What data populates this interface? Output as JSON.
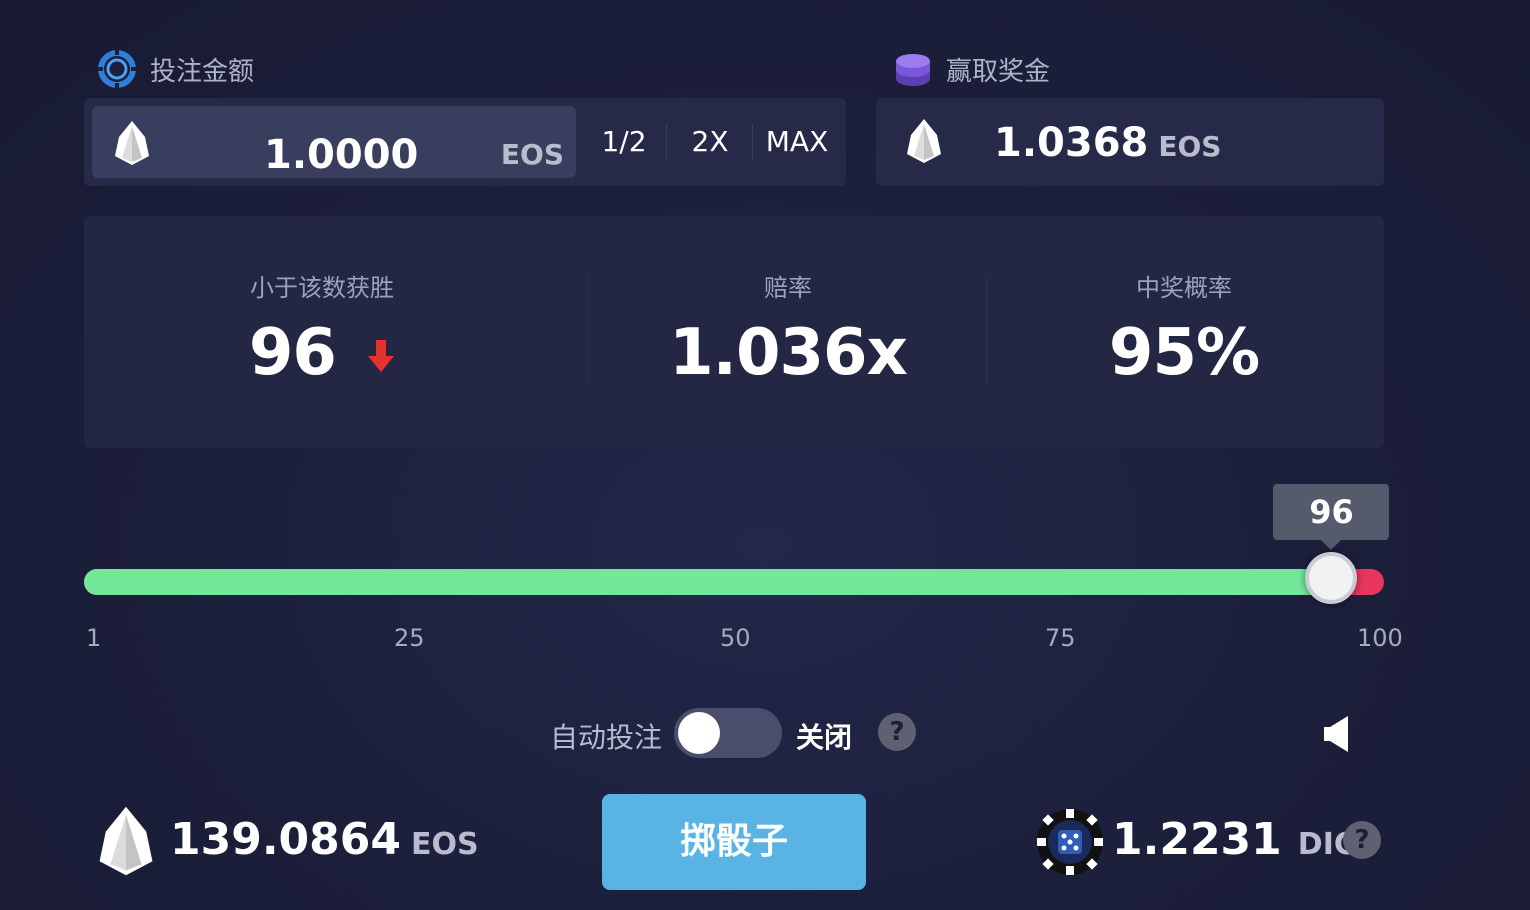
{
  "bet": {
    "label": "投注金额",
    "value": "1.0000",
    "unit": "EOS",
    "half_label": "1/2",
    "double_label": "2X",
    "max_label": "MAX"
  },
  "win": {
    "label": "赢取奖金",
    "value": "1.0368",
    "unit": "EOS"
  },
  "stats": {
    "roll_under_label": "小于该数获胜",
    "roll_under_value": "96",
    "payout_label": "赔率",
    "payout_value": "1.036x",
    "chance_label": "中奖概率",
    "chance_value": "95%"
  },
  "slider": {
    "value": 96,
    "min": 1,
    "max": 100,
    "tooltip": "96",
    "ticks": [
      "1",
      "25",
      "50",
      "75",
      "100"
    ],
    "win_color": "#74e89a",
    "lose_color": "#e8365f"
  },
  "auto_bet": {
    "label": "自动投注",
    "state": "关闭",
    "help": "?"
  },
  "balance": {
    "value": "139.0864",
    "unit": "EOS"
  },
  "roll_button": {
    "label": "掷骰子"
  },
  "dice_token": {
    "value": "1.2231",
    "unit": "DICE",
    "help": "?"
  },
  "icons": {
    "bet": "chip-icon",
    "win": "coin-stack-icon",
    "currency": "eos-icon",
    "roll_direction": "arrow-down-icon",
    "sound": "speaker-icon",
    "dice_token": "dice-chip-icon"
  }
}
